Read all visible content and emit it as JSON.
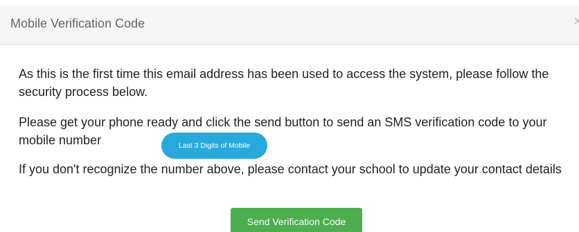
{
  "modal": {
    "title": "Mobile Verification Code",
    "close_label": "×",
    "paragraphs": [
      "As this is the first time this email address has been used to access the system, please follow the security process below.",
      "Please get your phone ready and click the send button to send an SMS verification code to your mobile number",
      "If you don't recognize the number above, please contact your school to update your contact details"
    ],
    "phone_badge": "Last 3 Digits of Mobile",
    "send_button_label": "Send Verification Code"
  },
  "colors": {
    "header_background": "#f5f5f5",
    "badge": "#29a8dc",
    "send_button": "#4cae4c",
    "body_text": "#222222"
  },
  "icons": {
    "close": "close-icon"
  }
}
